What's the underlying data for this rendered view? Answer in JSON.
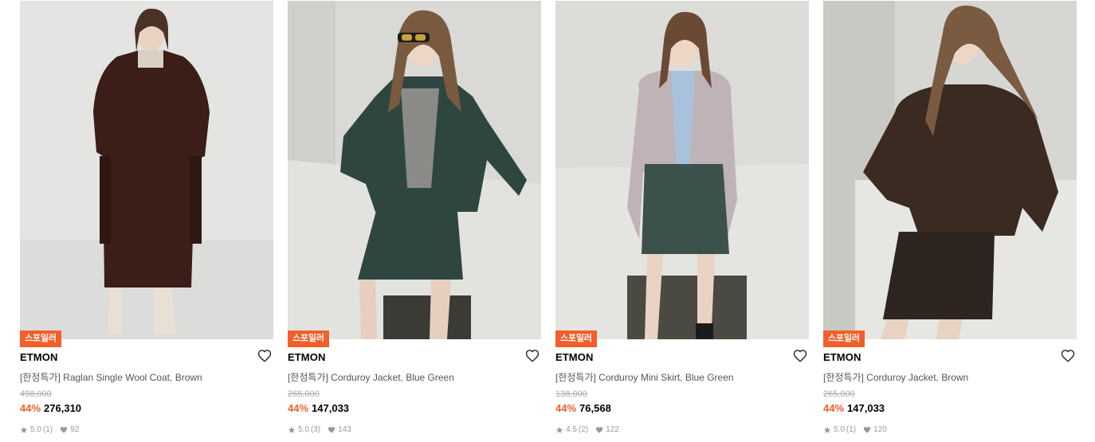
{
  "products": [
    {
      "badge": "스포일러",
      "brand": "ETMON",
      "name": "[한정특가] Raglan Single Wool Coat, Brown",
      "original_price": "498,000",
      "discount": "44%",
      "price": "276,310",
      "rating": "5.0",
      "review_count": "(1)",
      "likes": "92"
    },
    {
      "badge": "스포일러",
      "brand": "ETMON",
      "name": "[한정특가] Corduroy Jacket, Blue Green",
      "original_price": "265,000",
      "discount": "44%",
      "price": "147,033",
      "rating": "5.0",
      "review_count": "(3)",
      "likes": "143"
    },
    {
      "badge": "스포일러",
      "brand": "ETMON",
      "name": "[한정특가] Corduroy Mini Skirt, Blue Green",
      "original_price": "138,000",
      "discount": "44%",
      "price": "76,568",
      "rating": "4.5",
      "review_count": "(2)",
      "likes": "122"
    },
    {
      "badge": "스포일러",
      "brand": "ETMON",
      "name": "[한정특가] Corduroy Jacket, Brown",
      "original_price": "265,000",
      "discount": "44%",
      "price": "147,033",
      "rating": "5.0",
      "review_count": "(1)",
      "likes": "120"
    }
  ],
  "icons": {
    "wishlist": "heart-outline-icon",
    "rating": "star-icon",
    "likes": "heart-filled-icon"
  },
  "colors": {
    "badge_bg": "#f25f2a",
    "discount_text": "#f25f2a",
    "price_text": "#000000",
    "muted_text": "#999999"
  }
}
